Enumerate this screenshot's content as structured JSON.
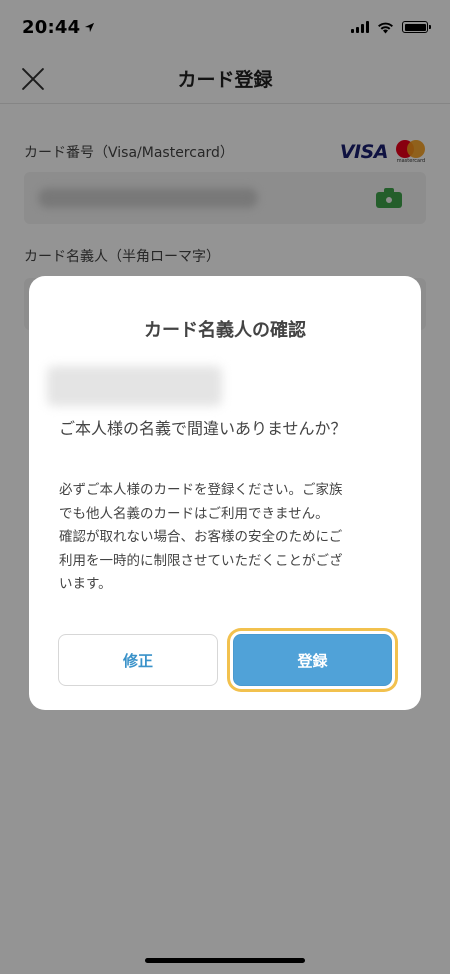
{
  "status_bar": {
    "time": "20:44"
  },
  "header": {
    "title": "カード登録"
  },
  "form": {
    "card_number_label": "カード番号（Visa/Mastercard）",
    "brands": {
      "visa": "VISA",
      "mastercard": "mastercard"
    },
    "card_holder_label": "カード名義人（半角ローマ字）"
  },
  "dialog": {
    "title": "カード名義人の確認",
    "question": "ご本人様の名義で間違いありませんか？",
    "notice": "必ずご本人様のカードを登録ください。ご家族\nでも他人名義のカードはご利用できません。\n確認が取れない場合、お客様の安全のためにご\n利用を一時的に制限させていただくことがござ\nいます。",
    "edit_button": "修正",
    "register_button": "登録"
  },
  "colors": {
    "accent": "#50a2d8",
    "edit_text": "#3a92c9",
    "focus_ring": "#f2c14e",
    "camera": "#3ea34a"
  },
  "icons": {
    "close": "close-icon",
    "camera": "camera-icon",
    "location": "location-arrow-icon",
    "signal": "signal-icon",
    "wifi": "wifi-icon",
    "battery": "battery-icon"
  }
}
